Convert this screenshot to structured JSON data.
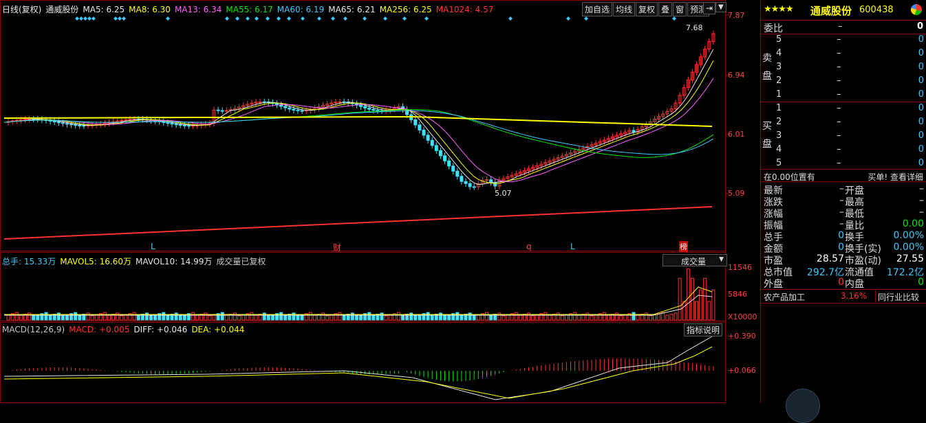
{
  "main": {
    "legend": [
      {
        "label": "日线(复权)",
        "color": "#e8e8e8"
      },
      {
        "label": "通威股份",
        "color": "#e8e8e8"
      },
      {
        "label": "MA5: 6.25",
        "color": "#e8e8e8"
      },
      {
        "label": "MA8: 6.30",
        "color": "#ffff00"
      },
      {
        "label": "MA13: 6.34",
        "color": "#ff60ff"
      },
      {
        "label": "MA55: 6.17",
        "color": "#00e600"
      },
      {
        "label": "MA60: 6.19",
        "color": "#40c8ff"
      },
      {
        "label": "MA65: 6.21",
        "color": "#e8e8e8"
      },
      {
        "label": "MA256: 6.25",
        "color": "#ffff00"
      },
      {
        "label": "MA1024: 4.57",
        "color": "#ff3232"
      }
    ],
    "toolbar": [
      "加自选",
      "均线",
      "复权",
      "叠",
      "窗",
      "预测"
    ],
    "price_axis": [
      "7.87",
      "6.94",
      "6.01",
      "5.09"
    ],
    "high_label": "7.68",
    "low_label": "5.07",
    "event_markers": [
      "L",
      "财",
      "q",
      "L",
      "榜"
    ]
  },
  "volume": {
    "legend": [
      {
        "label": "总手: 15.33万",
        "color": "#40c8ff"
      },
      {
        "label": "MAVOL5: 16.60万",
        "color": "#ffff00"
      },
      {
        "label": "MAVOL10: 14.99万",
        "color": "#e8e8e8"
      },
      {
        "label": "成交量已复权",
        "color": "#c8c8c8"
      }
    ],
    "selector": "成交量",
    "axis": [
      "11546",
      "5846",
      "X10000"
    ]
  },
  "macd": {
    "legend": [
      {
        "label": "MACD(12,26,9)",
        "color": "#c8c8c8"
      },
      {
        "label": "MACD: +0.005",
        "color": "#ff3232"
      },
      {
        "label": "DIFF: +0.046",
        "color": "#e8e8e8"
      },
      {
        "label": "DEA: +0.044",
        "color": "#ffff00"
      }
    ],
    "help": "指标说明",
    "axis": [
      "+0.390",
      "+0.066"
    ]
  },
  "panel": {
    "stars": "★★★★",
    "name": "通威股份",
    "code": "600438",
    "weibi_label": "委比",
    "weibi_val": "–",
    "weibi_right": "0",
    "sell_label": "卖盘",
    "buy_label": "买盘",
    "sell": [
      {
        "n": "5",
        "p": "–",
        "q": "0"
      },
      {
        "n": "4",
        "p": "–",
        "q": "0"
      },
      {
        "n": "3",
        "p": "–",
        "q": "0"
      },
      {
        "n": "2",
        "p": "–",
        "q": "0"
      },
      {
        "n": "1",
        "p": "–",
        "q": "0"
      }
    ],
    "buy": [
      {
        "n": "1",
        "p": "–",
        "q": "0"
      },
      {
        "n": "2",
        "p": "–",
        "q": "0"
      },
      {
        "n": "3",
        "p": "–",
        "q": "0"
      },
      {
        "n": "4",
        "p": "–",
        "q": "0"
      },
      {
        "n": "5",
        "p": "–",
        "q": "0"
      }
    ],
    "status_left": "在0.00位置有",
    "status_right": "买单! 查看详细",
    "stats": [
      {
        "k": "最新",
        "v": "–",
        "k2": "开盘",
        "v2": "–"
      },
      {
        "k": "涨跌",
        "v": "–",
        "k2": "最高",
        "v2": "–"
      },
      {
        "k": "涨幅",
        "v": "–",
        "k2": "最低",
        "v2": "–"
      },
      {
        "k": "振幅",
        "v": "–",
        "k2": "量比",
        "v2": "0.00"
      },
      {
        "k": "总手",
        "v": "0",
        "k2": "换手",
        "v2": "0.00%"
      },
      {
        "k": "金额",
        "v": "0",
        "k2": "换手(实)",
        "v2": "0.00%"
      },
      {
        "k": "市盈",
        "v": "28.57",
        "k2": "市盈(动)",
        "v2": "27.55"
      },
      {
        "k": "总市值",
        "v": "292.7亿",
        "k2": "流通值",
        "v2": "172.2亿"
      },
      {
        "k": "外盘",
        "v": "0",
        "k2": "内盘",
        "v2": "0"
      }
    ],
    "industry": "农产品加工",
    "industry_pct": "3.16%",
    "compare_button": "同行业比较"
  }
}
